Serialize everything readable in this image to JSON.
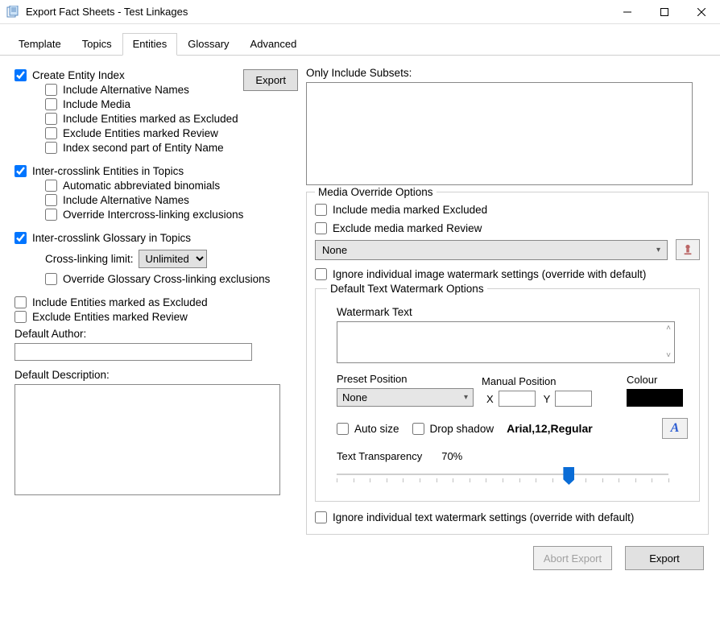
{
  "window": {
    "title": "Export Fact Sheets - Test Linkages"
  },
  "tabs": [
    "Template",
    "Topics",
    "Entities",
    "Glossary",
    "Advanced"
  ],
  "active_tab_index": 2,
  "left": {
    "export_btn": "Export",
    "create_index": {
      "label": "Create Entity Index",
      "checked": true
    },
    "create_index_children": [
      {
        "label": "Include Alternative Names",
        "checked": false
      },
      {
        "label": "Include Media",
        "checked": false
      },
      {
        "label": "Include Entities marked as Excluded",
        "checked": false
      },
      {
        "label": "Exclude Entities marked Review",
        "checked": false
      },
      {
        "label": "Index second part of Entity Name",
        "checked": false
      }
    ],
    "intercross_entities": {
      "label": "Inter-crosslink Entities in Topics",
      "checked": true
    },
    "intercross_entities_children": [
      {
        "label": "Automatic abbreviated binomials",
        "checked": false
      },
      {
        "label": "Include Alternative Names",
        "checked": false
      },
      {
        "label": "Override Intercross-linking exclusions",
        "checked": false
      }
    ],
    "intercross_glossary": {
      "label": "Inter-crosslink Glossary in Topics",
      "checked": true
    },
    "cross_link_limit_label": "Cross-linking limit:",
    "cross_link_limit_value": "Unlimited",
    "glossary_override": {
      "label": "Override Glossary Cross-linking exclusions",
      "checked": false
    },
    "include_entities_excluded": {
      "label": "Include Entities marked as Excluded",
      "checked": false
    },
    "exclude_entities_review": {
      "label": "Exclude Entities marked Review",
      "checked": false
    },
    "default_author_label": "Default Author:",
    "default_author_value": "",
    "default_desc_label": "Default Description:",
    "default_desc_value": ""
  },
  "right": {
    "only_subsets_label": "Only Include Subsets:",
    "media_override_legend": "Media Override Options",
    "include_media_excluded": {
      "label": "Include media marked Excluded",
      "checked": false
    },
    "exclude_media_review": {
      "label": "Exclude media marked Review",
      "checked": false
    },
    "media_select_value": "None",
    "ignore_image_watermark": {
      "label": "Ignore individual image watermark settings (override with default)",
      "checked": false
    },
    "text_watermark_legend": "Default Text Watermark Options",
    "watermark_text_label": "Watermark Text",
    "watermark_text_value": "",
    "preset_position_label": "Preset Position",
    "preset_position_value": "None",
    "manual_position_label": "Manual Position",
    "x_label": "X",
    "y_label": "Y",
    "x_value": "",
    "y_value": "",
    "colour_label": "Colour",
    "colour_value": "#000000",
    "auto_size": {
      "label": "Auto size",
      "checked": false
    },
    "drop_shadow": {
      "label": "Drop shadow",
      "checked": false
    },
    "font_spec": "Arial,12,Regular",
    "transparency_label": "Text Transparency",
    "transparency_value": "70%",
    "transparency_percent": 70,
    "ignore_text_watermark": {
      "label": "Ignore individual text watermark settings (override with default)",
      "checked": false
    }
  },
  "footer": {
    "abort": "Abort Export",
    "export": "Export"
  }
}
